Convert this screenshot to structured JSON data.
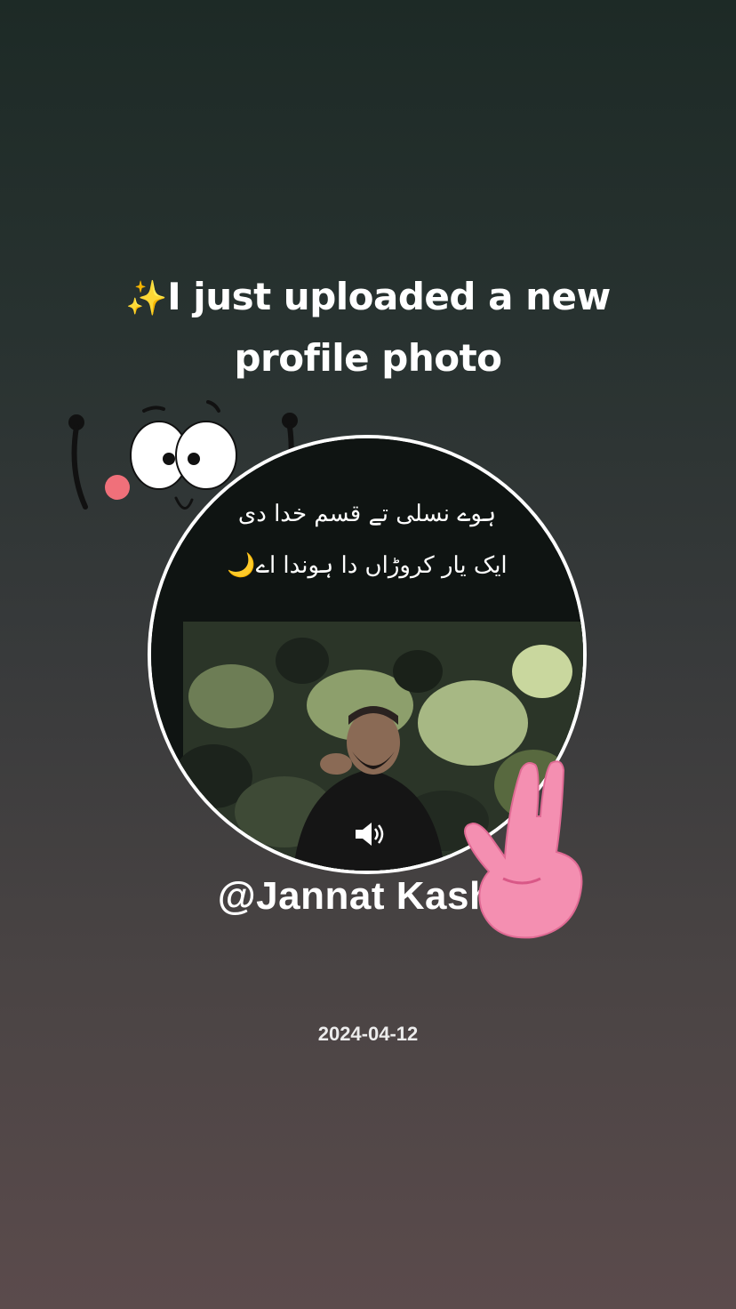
{
  "post": {
    "sparkle_icon": "✨",
    "headline": "I just uploaded a new profile photo",
    "handle": "@Jannat Kashif",
    "date": "2024-04-12"
  },
  "avatar": {
    "caption_line_1": "ہوے نسلی تے قسم خدا دی",
    "caption_line_2": "ایک یار کروڑاں دا ہوندا اے",
    "moon_icon": "🌙",
    "audio_icon": "speaker-icon"
  },
  "stickers": {
    "face": "cute-face-sticker",
    "hand": "victory-hand-sticker"
  },
  "colors": {
    "background_top": "#1d2a26",
    "background_bottom": "#5b4b4c",
    "ring": "#ffffff",
    "sparkle": "#f3c623",
    "blush": "#f0707a",
    "hand": "#f48fb1"
  }
}
